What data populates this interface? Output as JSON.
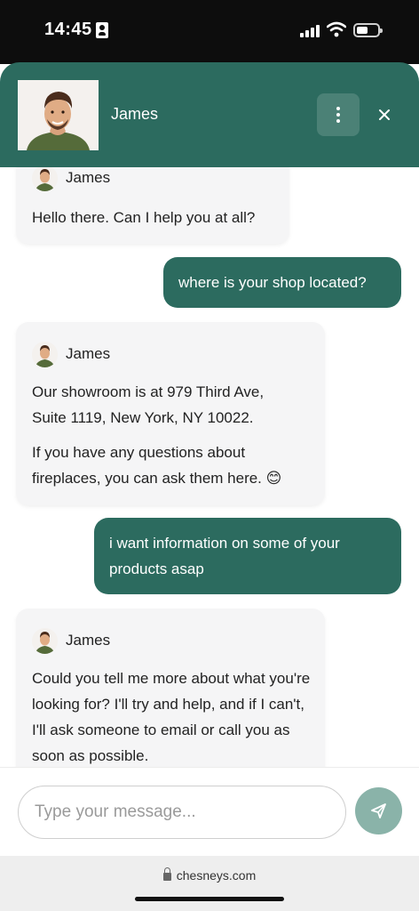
{
  "status_bar": {
    "time": "14:45"
  },
  "header": {
    "agent_name": "James"
  },
  "messages": [
    {
      "sender": "agent",
      "name": "James",
      "paragraphs": [
        "Hello there. Can I help you at all?"
      ]
    },
    {
      "sender": "user",
      "text": "where is your shop located?"
    },
    {
      "sender": "agent",
      "name": "James",
      "paragraphs": [
        "Our showroom is at 979 Third Ave, Suite 1119, New York, NY 10022.",
        "If you have any questions about fireplaces, you can ask them here. 😊"
      ]
    },
    {
      "sender": "user",
      "text": "i want information on some of your products asap"
    },
    {
      "sender": "agent",
      "name": "James",
      "paragraphs": [
        "Could you tell me more about what you're looking for? I'll try and help, and if I can't, I'll ask someone to email or call you as soon as possible."
      ]
    }
  ],
  "composer": {
    "placeholder": "Type your message..."
  },
  "browser": {
    "url": "chesneys.com"
  },
  "colors": {
    "brand": "#2c6b5f",
    "send_button": "#8ab3a9",
    "agent_bubble": "#f5f5f6"
  }
}
